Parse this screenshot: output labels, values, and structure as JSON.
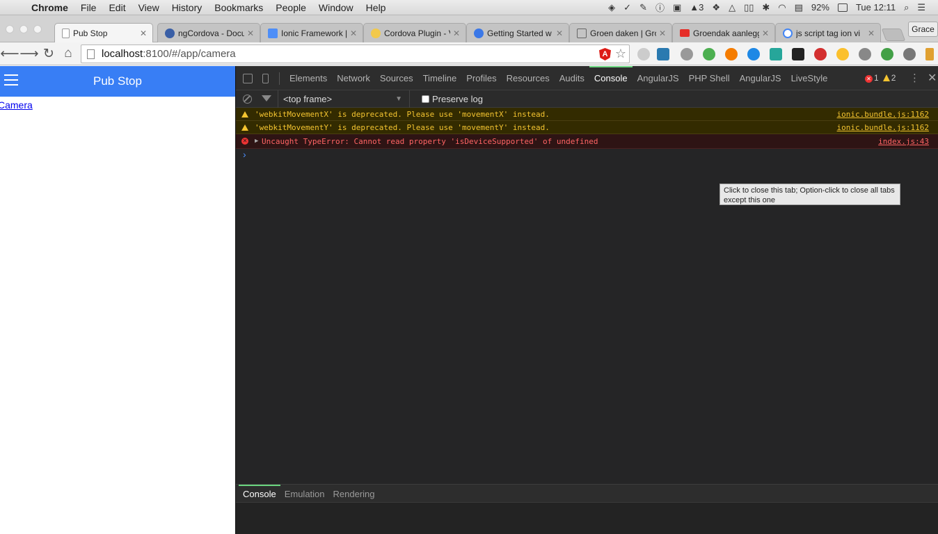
{
  "menubar": {
    "app": "Chrome",
    "items": [
      "File",
      "Edit",
      "View",
      "History",
      "Bookmarks",
      "People",
      "Window",
      "Help"
    ],
    "status_count": "3",
    "battery": "92%",
    "clock": "Tue 12:11"
  },
  "tabs": [
    {
      "title": "Pub Stop",
      "icon": "page-icon",
      "active": true
    },
    {
      "title": "ngCordova - Docu",
      "icon": "ngcordova-icon"
    },
    {
      "title": "Ionic Framework |",
      "icon": "ionic-icon"
    },
    {
      "title": "Cordova Plugin - V",
      "icon": "cordova-icon"
    },
    {
      "title": "Getting Started w",
      "icon": "chrome-icon"
    },
    {
      "title": "Groen daken | Gro",
      "icon": "folder-icon"
    },
    {
      "title": "Groendak aanlegg",
      "icon": "youtube-icon"
    },
    {
      "title": "js script tag ion vi",
      "icon": "google-icon"
    }
  ],
  "profile_name": "Grace",
  "address": {
    "host": "localhost",
    "path": ":8100/#/app/camera"
  },
  "app": {
    "title": "Pub Stop",
    "link": "Camera",
    "bar_color": "#387ef5"
  },
  "devtools": {
    "tabs": [
      "Elements",
      "Network",
      "Sources",
      "Timeline",
      "Profiles",
      "Resources",
      "Audits",
      "Console",
      "AngularJS",
      "PHP Shell",
      "AngularJS",
      "LiveStyle"
    ],
    "active_tab": "Console",
    "error_count": "1",
    "warning_count": "2",
    "frame": "<top frame>",
    "preserve_log": "Preserve log",
    "messages": [
      {
        "level": "warning",
        "text": "'webkitMovementX' is deprecated. Please use 'movementX' instead.",
        "source": "ionic.bundle.js:1162"
      },
      {
        "level": "warning",
        "text": "'webkitMovementY' is deprecated. Please use 'movementY' instead.",
        "source": "ionic.bundle.js:1162"
      },
      {
        "level": "error",
        "text": "Uncaught TypeError: Cannot read property 'isDeviceSupported' of undefined",
        "source": "index.js:43"
      }
    ],
    "prompt": "›",
    "tooltip": "Click to close this tab; Option-click to close all tabs except this one",
    "drawer_tabs": [
      "Console",
      "Emulation",
      "Rendering"
    ]
  }
}
